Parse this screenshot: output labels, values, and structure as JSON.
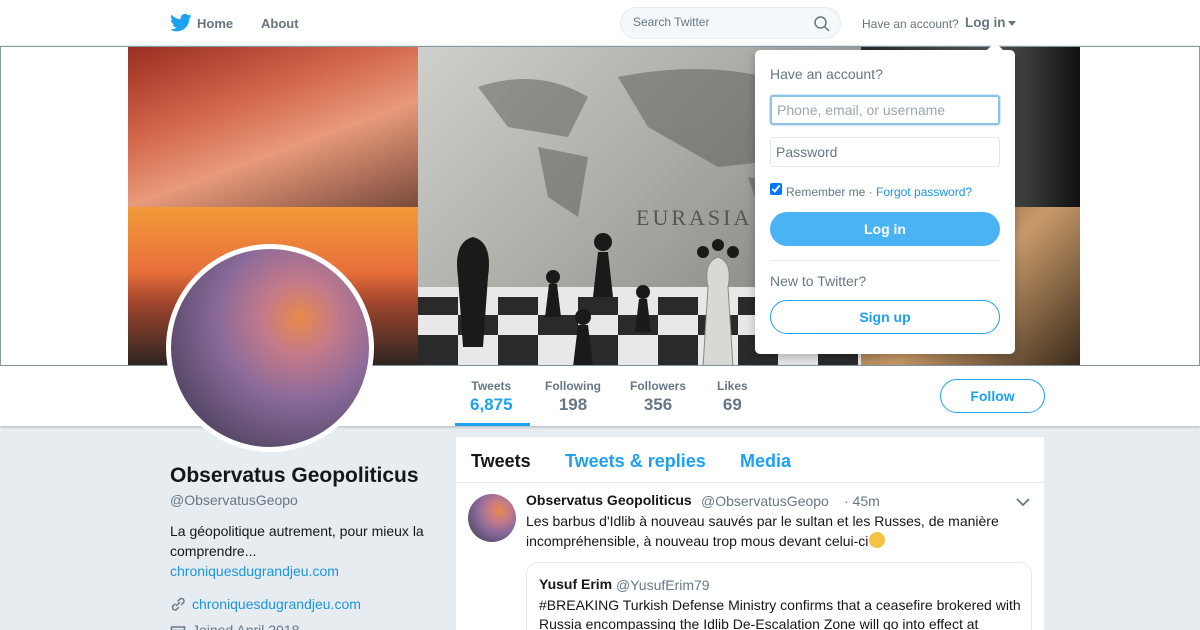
{
  "nav": {
    "logo_icon": "twitter-bird-icon",
    "home_label": "Home",
    "about_label": "About",
    "search_placeholder": "Search Twitter",
    "have_account_text": "Have an account?",
    "login_label": "Log in"
  },
  "banner": {
    "overlay_text": "EURASIA"
  },
  "stats": [
    {
      "label": "Tweets",
      "value": "6,875"
    },
    {
      "label": "Following",
      "value": "198"
    },
    {
      "label": "Followers",
      "value": "356"
    },
    {
      "label": "Likes",
      "value": "69"
    }
  ],
  "follow_label": "Follow",
  "profile": {
    "name": "Observatus Geopoliticus",
    "handle": "@ObservatusGeopo",
    "bio": "La géopolitique autrement, pour mieux la comprendre...",
    "bio_link": "chroniquesdugrandjeu.com",
    "url": "chroniquesdugrandjeu.com",
    "joined": "Joined April 2018"
  },
  "timeline": {
    "tabs": [
      "Tweets",
      "Tweets & replies",
      "Media"
    ],
    "tweet": {
      "name": "Observatus Geopoliticus",
      "handle": "@ObservatusGeopo",
      "time": "· 45m",
      "text": "Les barbus d'Idlib à nouveau sauvés par le sultan et les Russes, de manière incompréhensible, à nouveau trop mous devant celui-ci",
      "quote": {
        "name": "Yusuf Erim",
        "handle": "@YusufErim79",
        "text": "#BREAKING Turkish Defense Ministry confirms that a ceasefire brokered with Russia encompassing the Idlib De-Escalation Zone will go into effect at"
      }
    }
  },
  "login_dropdown": {
    "title": "Have an account?",
    "username_placeholder": "Phone, email, or username",
    "password_placeholder": "Password",
    "remember_label": "Remember me ·",
    "forgot_label": "Forgot password?",
    "login_button": "Log in",
    "new_label": "New to Twitter?",
    "signup_button": "Sign up"
  },
  "colors": {
    "accent": "#1da1f2",
    "link": "#1b95e0",
    "muted": "#657786",
    "background": "#e6ecf0"
  }
}
